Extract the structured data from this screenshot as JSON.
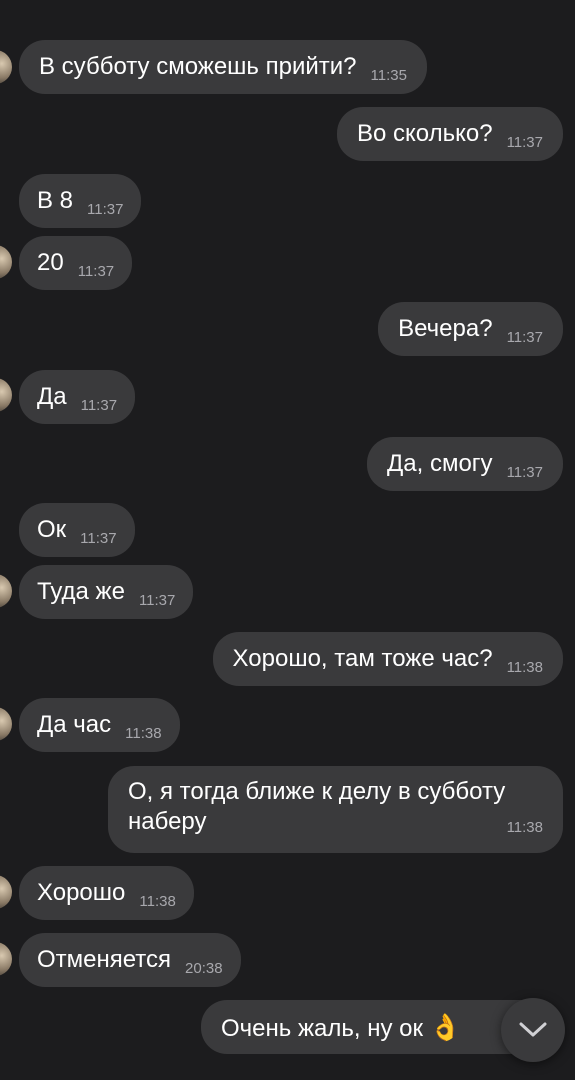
{
  "messages": [
    {
      "text": "В субботу сможешь прийти?",
      "time": "11:35",
      "side": "in"
    },
    {
      "text": "Во сколько?",
      "time": "11:37",
      "side": "out"
    },
    {
      "text": "В 8",
      "time": "11:37",
      "side": "in"
    },
    {
      "text": "20",
      "time": "11:37",
      "side": "in"
    },
    {
      "text": "Вечера?",
      "time": "11:37",
      "side": "out"
    },
    {
      "text": "Да",
      "time": "11:37",
      "side": "in"
    },
    {
      "text": "Да, смогу",
      "time": "11:37",
      "side": "out"
    },
    {
      "text": "Ок",
      "time": "11:37",
      "side": "in"
    },
    {
      "text": "Туда же",
      "time": "11:37",
      "side": "in"
    },
    {
      "text": "Хорошо, там тоже час?",
      "time": "11:38",
      "side": "out"
    },
    {
      "text": "Да час",
      "time": "11:38",
      "side": "in"
    },
    {
      "text": "О, я тогда ближе к делу в субботу наберу",
      "time": "11:38",
      "side": "out"
    },
    {
      "text": "Хорошо",
      "time": "11:38",
      "side": "in"
    },
    {
      "text": "Отменяется",
      "time": "20:38",
      "side": "in"
    },
    {
      "text": "Очень жаль, ну ок",
      "emoji": "👌",
      "side": "out"
    }
  ],
  "colors": {
    "background": "#1c1c1e",
    "bubble": "#3a3a3c",
    "text": "#ffffff",
    "time": "#a8a8ad"
  },
  "icons": {
    "scroll_down": "chevron-down-icon",
    "avatar": "avatar"
  }
}
